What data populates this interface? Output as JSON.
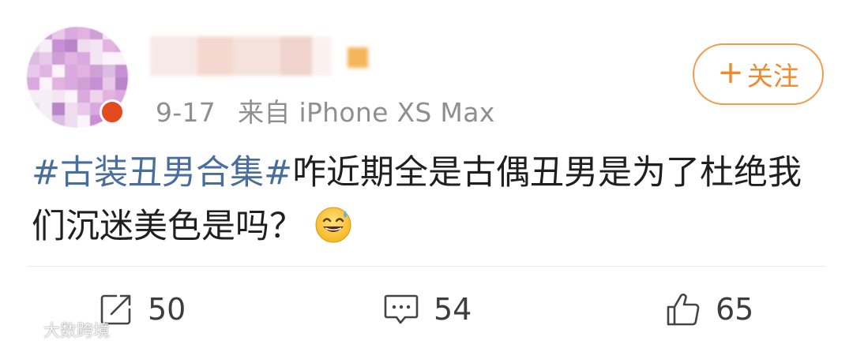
{
  "post": {
    "date": "9-17",
    "source": "来自 iPhone XS Max",
    "follow_label": "关注",
    "follow_plus": "+",
    "hashtag": "#古装丑男合集#",
    "text": "咋近期全是古偶丑男是为了杜绝我们沉迷美色是吗？",
    "emoji": "sweat-smile-emoji"
  },
  "actions": {
    "repost_count": "50",
    "comment_count": "54",
    "like_count": "65"
  },
  "watermark": {
    "text": "大数跨境"
  },
  "colors": {
    "accent_orange": "#f08a2c",
    "hashtag_blue": "#4a6e9c",
    "meta_gray": "#8f8f8f",
    "vip_badge": "#e34a1f"
  }
}
